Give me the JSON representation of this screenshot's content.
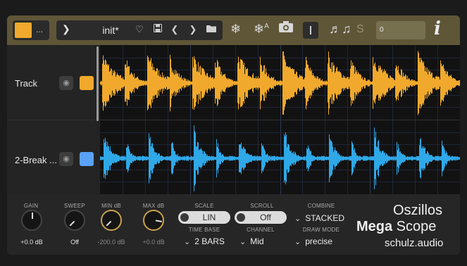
{
  "toolbar": {
    "accent_color": "#f0a92c",
    "swatch_menu": "...",
    "preset_name": "init*",
    "icons": [
      "chevron-down-icon",
      "heart-icon",
      "save-icon",
      "prev-icon",
      "next-icon",
      "folder-icon",
      "freeze-icon",
      "freeze-all-icon",
      "camera-icon",
      "cursor-icon",
      "notes-icon"
    ],
    "s_label": "S",
    "offset_value": "0",
    "info_label": "i"
  },
  "tracks": [
    {
      "name": "Track",
      "color": "#f0a92c"
    },
    {
      "name": "2-Break ...",
      "color": "#5aa2f5"
    }
  ],
  "controls": {
    "gain": {
      "label": "GAIN",
      "value": "+0.0 dB"
    },
    "sweep": {
      "label": "SWEEP",
      "value": "Off"
    },
    "min_db": {
      "label": "MIN dB",
      "value": "-200.0 dB"
    },
    "max_db": {
      "label": "MAX dB",
      "value": "+0.0 dB"
    },
    "scale": {
      "label": "SCALE",
      "value": "LIN"
    },
    "scroll": {
      "label": "SCROLL",
      "value": "Off"
    },
    "combine": {
      "label": "COMBINE",
      "value": "STACKED"
    },
    "time_base": {
      "label": "TIME BASE",
      "value": "2 BARS"
    },
    "channel": {
      "label": "CHANNEL",
      "value": "Mid"
    },
    "draw_mode": {
      "label": "DRAW MODE",
      "value": "precise"
    }
  },
  "brand": {
    "line1": "Oszillos",
    "line2_bold": "Mega",
    "line2_rest": " Scope",
    "line3": "schulz.audio"
  }
}
